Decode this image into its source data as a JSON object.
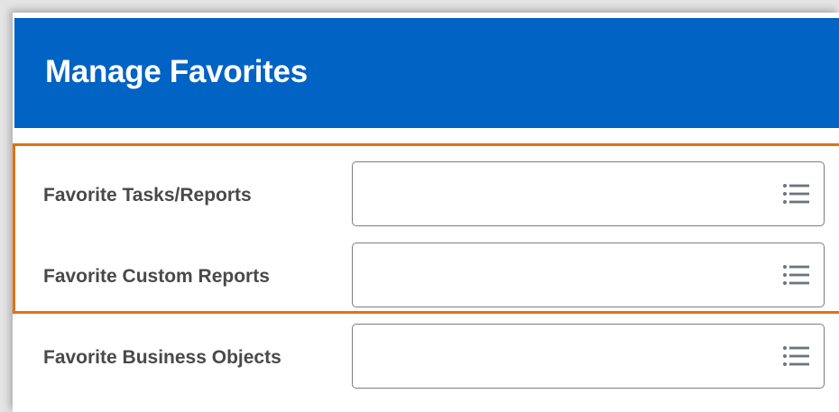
{
  "page": {
    "title": "Manage Favorites"
  },
  "fields": [
    {
      "label": "Favorite Tasks/Reports",
      "value": "",
      "icon": "prompt-list-icon"
    },
    {
      "label": "Favorite Custom Reports",
      "value": "",
      "icon": "prompt-list-icon"
    },
    {
      "label": "Favorite Business Objects",
      "value": "",
      "icon": "prompt-list-icon"
    }
  ],
  "colors": {
    "header_bg": "#0163c4",
    "highlight": "#e07312",
    "label_text": "#494949",
    "icon": "#6b7480"
  }
}
